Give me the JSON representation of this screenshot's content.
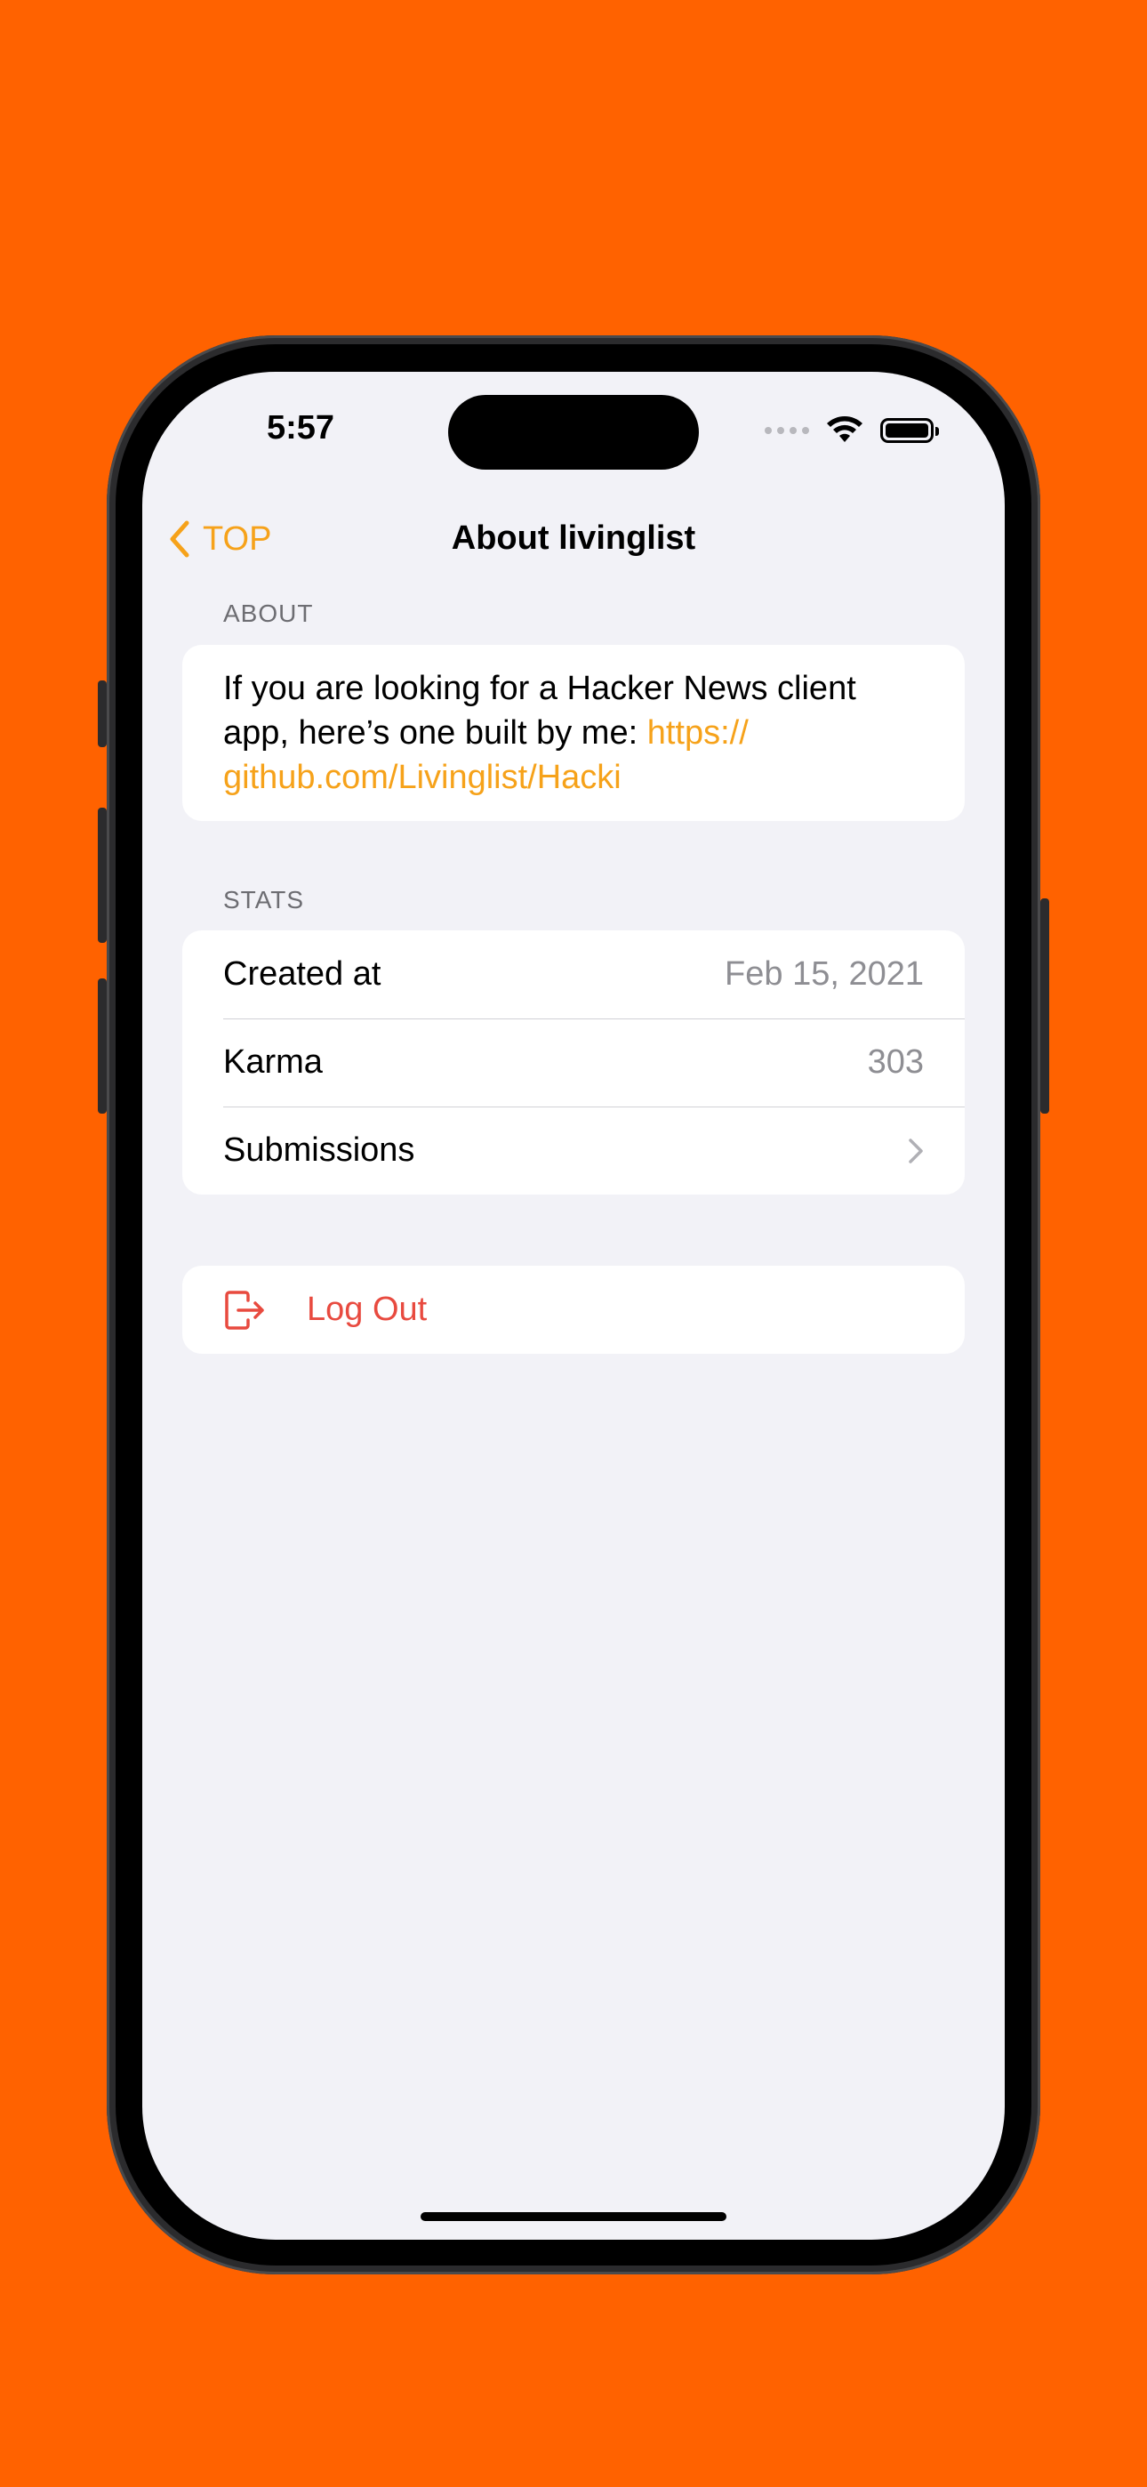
{
  "status_bar": {
    "time": "5:57"
  },
  "nav": {
    "back_label": "TOP",
    "title": "About livinglist"
  },
  "about": {
    "header": "ABOUT",
    "text": "If you are looking for a Hacker News client app, here’s one built by me: ",
    "link": "https://github.com/Livinglist/Hacki",
    "link_line1": "https://",
    "link_line2": "github.com/Livinglist/Hacki"
  },
  "stats": {
    "header": "STATS",
    "rows": [
      {
        "label": "Created at",
        "value": "Feb 15, 2021"
      },
      {
        "label": "Karma",
        "value": "303"
      },
      {
        "label": "Submissions",
        "value": ""
      }
    ]
  },
  "logout": {
    "label": "Log Out"
  },
  "colors": {
    "background": "#FF6200",
    "accent": "#F6A21A",
    "destructive": "#E84A3F",
    "screen": "#F2F2F7"
  },
  "icons": [
    "chevron-left-icon",
    "wifi-icon",
    "battery-icon",
    "chevron-right-icon",
    "logout-icon"
  ]
}
